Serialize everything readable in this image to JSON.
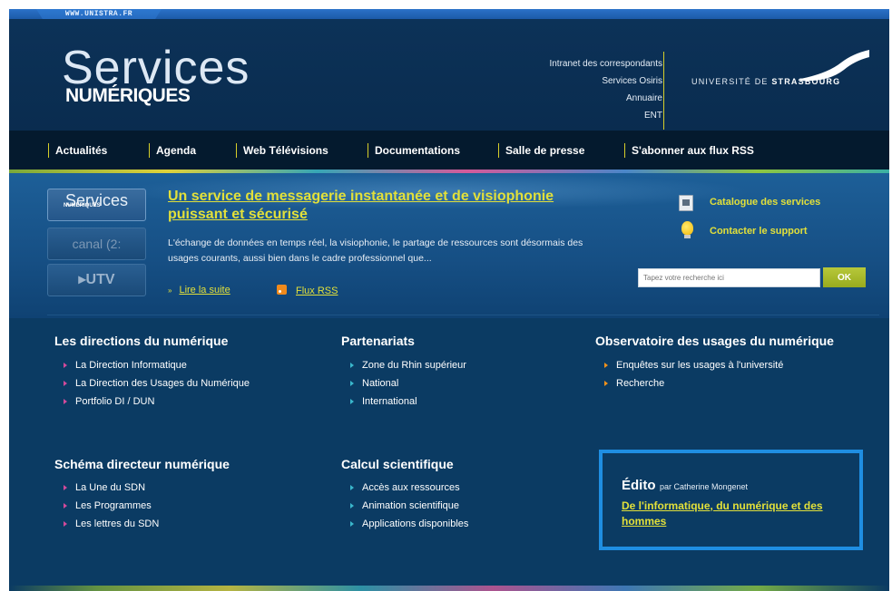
{
  "url_tab": "WWW.UNISTRA.FR",
  "logo": {
    "line1": "Services",
    "line2": "NUMÉRIQUES"
  },
  "quick_links": [
    "Intranet des correspondants",
    "Services Osiris",
    "Annuaire",
    "ENT"
  ],
  "university": {
    "prefix": "UNIVERSITÉ DE ",
    "name": "STRASBOURG"
  },
  "nav": [
    "Actualités",
    "Agenda",
    "Web Télévisions",
    "Documentations",
    "Salle de presse",
    "S'abonner aux flux RSS"
  ],
  "thumbs": [
    {
      "label": "Services",
      "sub": "NUMÉRIQUES",
      "icon": "services-numeriques-logo"
    },
    {
      "label": "canal (2:",
      "icon": "canal2-logo"
    },
    {
      "label": "▸UTV",
      "icon": "utv-logo"
    }
  ],
  "hero": {
    "title": "Un service de messagerie instantanée et de visiophonie puissant et sécurisé",
    "text": "L'échange de données en temps réel, la visiophonie, le partage de ressources sont désormais des usages courants, aussi bien dans le cadre professionnel que...",
    "read_more": "Lire la suite",
    "rss": "Flux RSS"
  },
  "services": {
    "catalogue": "Catalogue des services",
    "support": "Contacter le support"
  },
  "search": {
    "placeholder": "Tapez votre recherche ici",
    "button": "OK"
  },
  "blocks": [
    {
      "title": "Les directions du numérique",
      "bullet": "pink",
      "items": [
        "La Direction Informatique",
        "La Direction des Usages du Numérique",
        "Portfolio DI / DUN"
      ]
    },
    {
      "title": "Partenariats",
      "bullet": "cyan",
      "items": [
        "Zone du Rhin supérieur",
        "National",
        "International"
      ]
    },
    {
      "title": "Observatoire des usages du numérique",
      "bullet": "orange",
      "items": [
        "Enquêtes sur les usages à l'université",
        "Recherche"
      ]
    },
    {
      "title": "Schéma directeur numérique",
      "bullet": "pink",
      "items": [
        "La Une du SDN",
        "Les Programmes",
        "Les lettres du SDN"
      ]
    },
    {
      "title": "Calcul scientifique",
      "bullet": "cyan",
      "items": [
        "Accès aux ressources",
        "Animation scientifique",
        "Applications disponibles"
      ]
    }
  ],
  "edito": {
    "title": "Édito",
    "byline": "par Catherine Mongenet",
    "link": "De l'informatique, du numérique et des hommes"
  },
  "colors": {
    "background": "#0b3b63",
    "link_yellow": "#e2e03a",
    "accent_blue": "#1f8ee2",
    "ok_green": "#a6b82a"
  }
}
